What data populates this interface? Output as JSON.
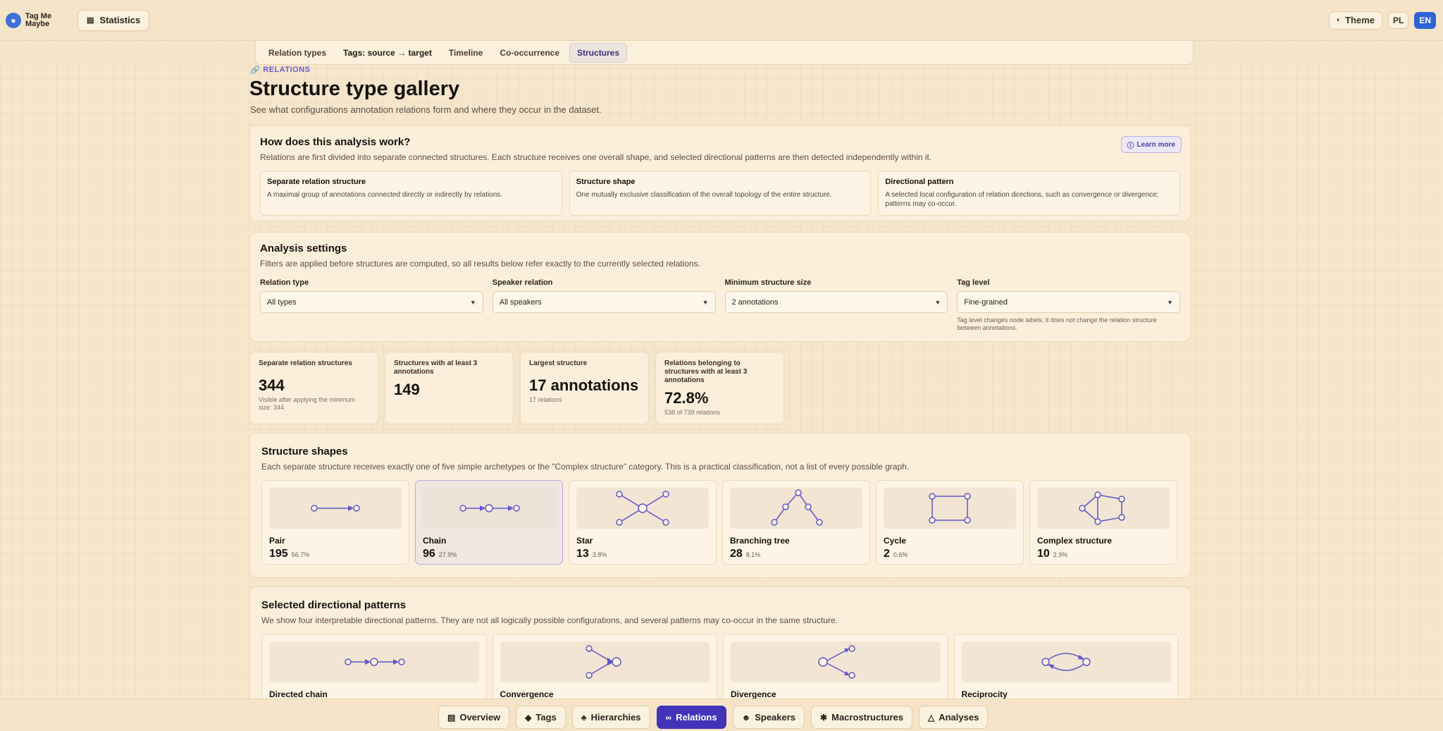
{
  "app": {
    "logo_line1": "Tag Me",
    "logo_line2": "Maybe",
    "statistics_label": "Statistics"
  },
  "topbar": {
    "theme_label": "Theme",
    "lang_pl": "PL",
    "lang_en": "EN"
  },
  "subnav": {
    "tabs": [
      {
        "label": "Relation types"
      },
      {
        "label": "Tags: source → target"
      },
      {
        "label": "Timeline"
      },
      {
        "label": "Co-occurrence"
      },
      {
        "label": "Structures"
      }
    ]
  },
  "page": {
    "section": "RELATIONS",
    "title": "Structure type gallery",
    "subtitle": "See what configurations annotation relations form and where they occur in the dataset."
  },
  "how": {
    "title": "How does this analysis work?",
    "desc": "Relations are first divided into separate connected structures. Each structure receives one overall shape, and selected directional patterns are then detected independently within it.",
    "learn_more": "Learn more",
    "boxes": [
      {
        "title": "Separate relation structure",
        "desc": "A maximal group of annotations connected directly or indirectly by relations."
      },
      {
        "title": "Structure shape",
        "desc": "One mutually exclusive classification of the overall topology of the entire structure."
      },
      {
        "title": "Directional pattern",
        "desc": "A selected local configuration of relation directions, such as convergence or divergence; patterns may co-occur."
      }
    ]
  },
  "settings": {
    "title": "Analysis settings",
    "desc": "Filters are applied before structures are computed, so all results below refer exactly to the currently selected relations.",
    "relation_type": {
      "label": "Relation type",
      "value": "All types"
    },
    "speaker_relation": {
      "label": "Speaker relation",
      "value": "All speakers"
    },
    "min_size": {
      "label": "Minimum structure size",
      "value": "2 annotations"
    },
    "tag_level": {
      "label": "Tag level",
      "value": "Fine-grained",
      "note": "Tag level changes node labels; it does not change the relation structure between annotations."
    }
  },
  "stats": [
    {
      "label": "Separate relation structures",
      "value": "344",
      "sub": "Visible after applying the minimum size: 344"
    },
    {
      "label": "Structures with at least 3 annotations",
      "value": "149",
      "sub": ""
    },
    {
      "label": "Largest structure",
      "value": "17 annotations",
      "sub": "17 relations"
    },
    {
      "label": "Relations belonging to structures with at least 3 annotations",
      "value": "72.8%",
      "sub": "538 of 739 relations"
    }
  ],
  "shapes": {
    "title": "Structure shapes",
    "desc": "Each separate structure receives exactly one of five simple archetypes or the \"Complex structure\" category. This is a practical classification, not a list of every possible graph.",
    "items": [
      {
        "name": "Pair",
        "count": "195",
        "pct": "56.7%",
        "icon": "pair-graph-icon"
      },
      {
        "name": "Chain",
        "count": "96",
        "pct": "27.9%",
        "icon": "chain-graph-icon"
      },
      {
        "name": "Star",
        "count": "13",
        "pct": "3.8%",
        "icon": "star-graph-icon"
      },
      {
        "name": "Branching tree",
        "count": "28",
        "pct": "8.1%",
        "icon": "tree-graph-icon"
      },
      {
        "name": "Cycle",
        "count": "2",
        "pct": "0.6%",
        "icon": "cycle-graph-icon"
      },
      {
        "name": "Complex structure",
        "count": "10",
        "pct": "2.9%",
        "icon": "complex-graph-icon"
      }
    ]
  },
  "patterns": {
    "title": "Selected directional patterns",
    "desc": "We show four interpretable directional patterns. They are not all logically possible configurations, and several patterns may co-occur in the same structure.",
    "items": [
      {
        "name": "Directed chain"
      },
      {
        "name": "Convergence"
      },
      {
        "name": "Divergence"
      },
      {
        "name": "Reciprocity"
      }
    ]
  },
  "bottomnav": [
    {
      "label": "Overview",
      "icon": "chart-icon"
    },
    {
      "label": "Tags",
      "icon": "tag-icon"
    },
    {
      "label": "Hierarchies",
      "icon": "tree-icon"
    },
    {
      "label": "Relations",
      "icon": "link-icon"
    },
    {
      "label": "Speakers",
      "icon": "speaker-icon"
    },
    {
      "label": "Macrostructures",
      "icon": "puzzle-icon"
    },
    {
      "label": "Analyses",
      "icon": "flask-icon"
    }
  ],
  "colors": {
    "accent": "#4333b8",
    "lang_active": "#2f63d6",
    "graph": "#6257c9"
  }
}
